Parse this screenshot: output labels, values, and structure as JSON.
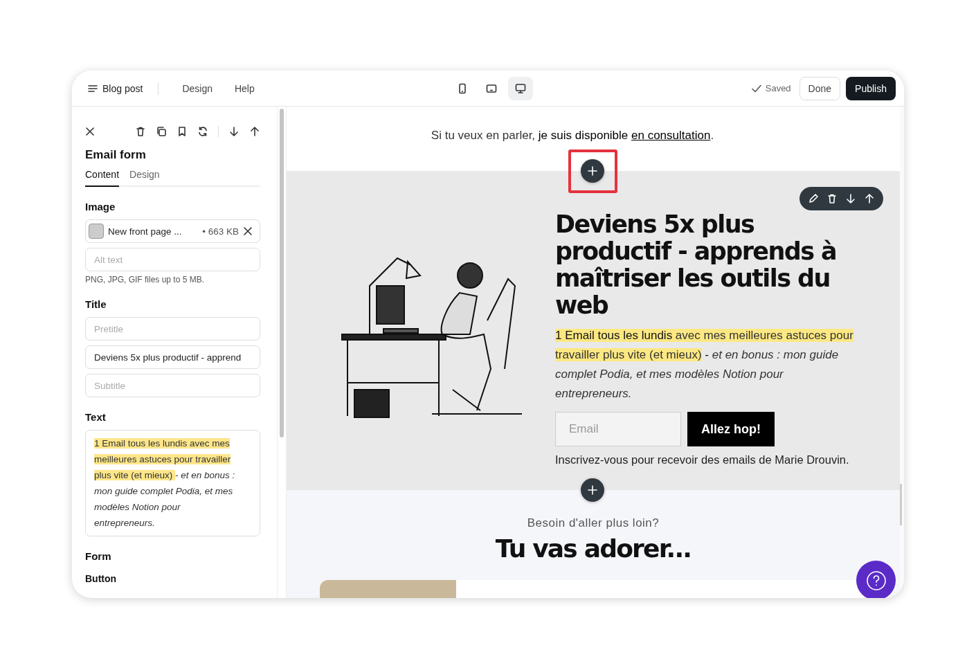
{
  "header": {
    "menu_label": "Blog post",
    "nav": [
      "Design",
      "Help"
    ],
    "devices": [
      {
        "kind": "phone",
        "selected": false
      },
      {
        "kind": "tablet",
        "selected": false
      },
      {
        "kind": "desktop",
        "selected": true
      }
    ],
    "saved": "Saved",
    "done": "Done",
    "publish": "Publish"
  },
  "sidebar": {
    "title": "Email form",
    "tabs": [
      {
        "label": "Content",
        "selected": true
      },
      {
        "label": "Design",
        "selected": false
      }
    ],
    "image_label": "Image",
    "image_file": "New front page ...",
    "image_size": "• 663 KB",
    "alt_placeholder": "Alt text",
    "image_hint": "PNG, JPG, GIF files up to 5 MB.",
    "title_label": "Title",
    "pretitle_placeholder": "Pretitle",
    "title_value": "Deviens 5x plus productif - apprend",
    "subtitle_placeholder": "Subtitle",
    "text_label": "Text",
    "text_segments": [
      {
        "text": "1 Email tous les lundis  avec mes meilleures astuces pour travailler plus vite (et mieux) ",
        "kind": "highlight"
      },
      {
        "text": " - et en bonus : mon guide complet Podia, et mes modèles Notion pour entrepreneurs.",
        "kind": "italic"
      }
    ],
    "form_label": "Form",
    "button_label": "Button"
  },
  "canvas": {
    "intro": [
      {
        "text": "Si tu veux en parler, ",
        "kind": "plain"
      },
      {
        "text": "je suis disponible ",
        "kind": "bold"
      },
      {
        "text": "en consultation",
        "kind": "link"
      },
      {
        "text": ".",
        "kind": "plain"
      }
    ],
    "heading": "Deviens 5x plus productif - apprends à maîtriser les outils du web",
    "body": [
      {
        "text": "1 Email tous les lundis",
        "kind": "highlight_strong"
      },
      {
        "text": " avec mes meilleures astuces pour travailler plus vite (et mieux)",
        "kind": "highlight"
      },
      {
        "text": " - ",
        "kind": "strong"
      },
      {
        "text": "et en bonus : mon guide complet Podia, et mes modèles Notion pour entrepreneurs.",
        "kind": "italic"
      }
    ],
    "email_placeholder": "Email",
    "submit": "Allez hop!",
    "caption": "Inscrivez-vous pour recevoir des emails de Marie Drouvin.",
    "pretitle": "Besoin d'aller plus loin?",
    "section_title": "Tu vas adorer..."
  }
}
